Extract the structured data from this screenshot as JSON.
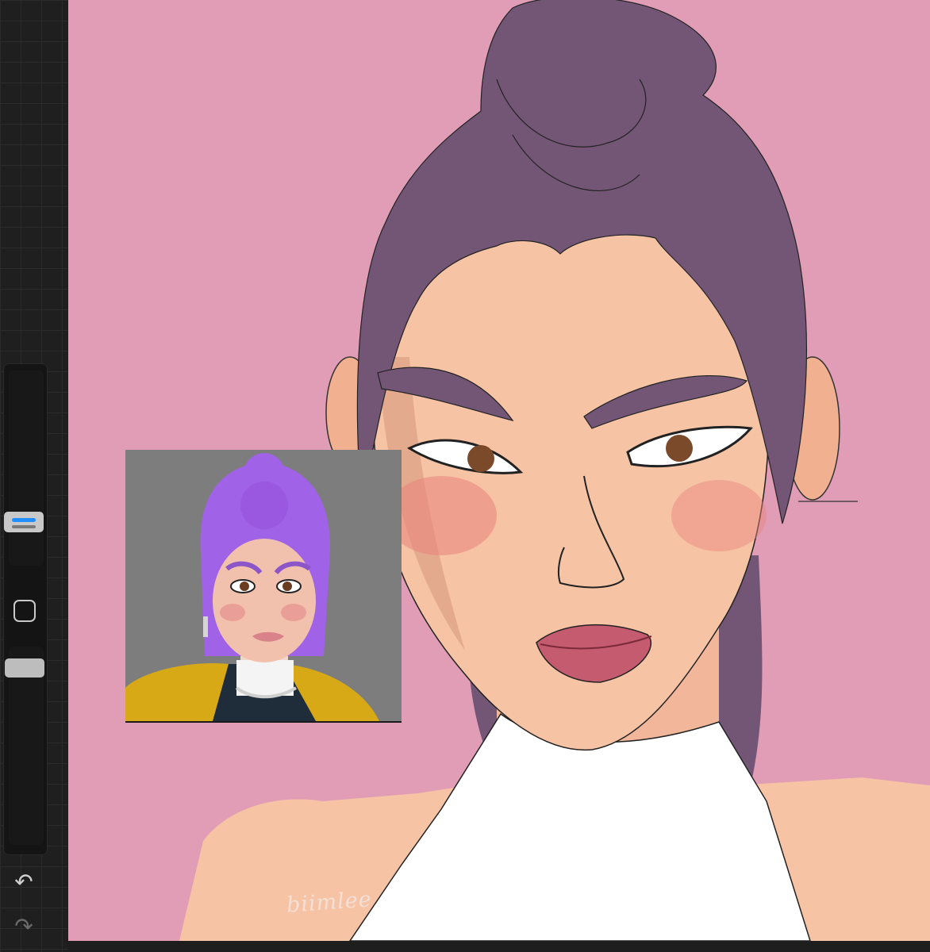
{
  "app": {
    "name": "drawing-app"
  },
  "toolbar": {
    "undo_icon": "undo-arrow-icon",
    "redo_icon": "redo-arrow-icon",
    "undo_glyph": "↶",
    "redo_glyph": "↷",
    "brush_size_level": 0.25,
    "brush_opacity_level": 0.1
  },
  "canvas": {
    "background_color": "#e09db5",
    "signature_text": "biimlee"
  },
  "reference": {
    "background_color": "#7d7d7d"
  },
  "colors": {
    "hair": "#735676",
    "skin": "#f6c3a5",
    "top": "#ffffff",
    "ref_hair": "#a062e6",
    "accent": "#1f8fff"
  }
}
